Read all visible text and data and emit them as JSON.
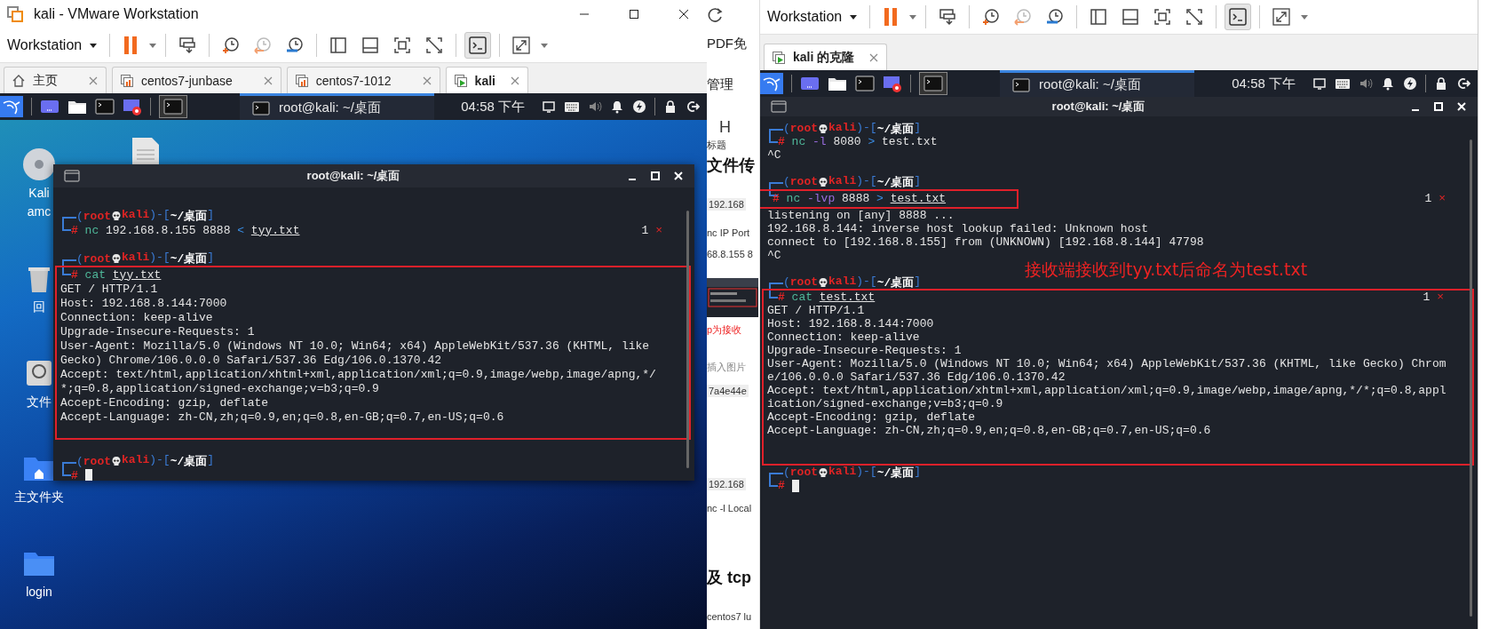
{
  "left_window": {
    "title": "kali - VMware Workstation",
    "menu": "Workstation",
    "console_pressed": true,
    "tabs": [
      {
        "label": "主页",
        "kind": "home",
        "selected": false
      },
      {
        "label": "centos7-junbase",
        "kind": "vm",
        "selected": false
      },
      {
        "label": "centos7-1012",
        "kind": "vm",
        "selected": false
      },
      {
        "label": "kali",
        "kind": "vm-running",
        "selected": true
      }
    ],
    "panel": {
      "window": "root@kali: ~/桌面",
      "clock": "04:58 下午"
    },
    "desktop_icons": [
      {
        "kind": "disc",
        "label_lines": [
          "Kali",
          "amc"
        ]
      },
      {
        "kind": "trash",
        "label_lines": [
          "回"
        ]
      },
      {
        "kind": "drive",
        "label_lines": [
          "文件"
        ]
      },
      {
        "kind": "home",
        "label_lines": [
          "主文件夹"
        ]
      },
      {
        "kind": "folder",
        "label_lines": [
          "login"
        ]
      }
    ],
    "terminal": {
      "title": "root@kali: ~/桌面",
      "entries": [
        {
          "kind": "blank"
        },
        {
          "kind": "prompt",
          "open": "(",
          "user": "root",
          "host": "kali",
          "sep": ")-[",
          "path": "~/桌面",
          "close": "]"
        },
        {
          "kind": "command",
          "hash": "#",
          "tokens": [
            {
              "kind": "cmd",
              "text": "nc"
            },
            {
              "kind": "arg",
              "text": "192.168.8.155 8888"
            },
            {
              "kind": "op",
              "text": "<"
            },
            {
              "kind": "file",
              "text": "tyy.txt"
            }
          ],
          "status": "1",
          "status_mark": "×"
        },
        {
          "kind": "blank"
        },
        {
          "kind": "prompt",
          "open": "(",
          "user": "root",
          "host": "kali",
          "sep": ")-[",
          "path": "~/桌面",
          "close": "]"
        },
        {
          "kind": "box",
          "entries": [
            {
              "kind": "command",
              "hash": "#",
              "tokens": [
                {
                  "kind": "cmd",
                  "text": "cat"
                },
                {
                  "kind": "file",
                  "text": "tyy.txt"
                }
              ]
            },
            {
              "kind": "output",
              "lines": [
                "GET / HTTP/1.1",
                "Host: 192.168.8.144:7000",
                "Connection: keep-alive",
                "Upgrade-Insecure-Requests: 1",
                "User-Agent: Mozilla/5.0 (Windows NT 10.0; Win64; x64) AppleWebKit/537.36 (KHTML, like",
                "Gecko) Chrome/106.0.0.0 Safari/537.36 Edg/106.0.1370.42",
                "Accept: text/html,application/xhtml+xml,application/xml;q=0.9,image/webp,image/apng,*/",
                "*;q=0.8,application/signed-exchange;v=b3;q=0.9",
                "Accept-Encoding: gzip, deflate",
                "Accept-Language: zh-CN,zh;q=0.9,en;q=0.8,en-GB;q=0.7,en-US;q=0.6"
              ]
            },
            {
              "kind": "blank"
            }
          ]
        },
        {
          "kind": "blank"
        },
        {
          "kind": "prompt",
          "open": "(",
          "user": "root",
          "host": "kali",
          "sep": ")-[",
          "path": "~/桌面",
          "close": "]"
        },
        {
          "kind": "command",
          "hash": "#",
          "cursor": true
        }
      ]
    }
  },
  "browser_strip": {
    "items": [
      {
        "kind": "reload"
      },
      {
        "kind": "text",
        "text": "PDF免"
      },
      {
        "kind": "text",
        "text": "管理"
      },
      {
        "kind": "big",
        "text": "H"
      },
      {
        "kind": "small",
        "text": "标题"
      },
      {
        "kind": "heading",
        "text": "文件传"
      },
      {
        "kind": "code",
        "text": "192.168"
      },
      {
        "kind": "small",
        "text": "nc IP Port"
      },
      {
        "kind": "small",
        "text": "68.8.155 8"
      },
      {
        "kind": "thumb"
      },
      {
        "kind": "red",
        "text": "p为接收"
      },
      {
        "kind": "muted",
        "text": "插入图片"
      },
      {
        "kind": "code",
        "text": "7a4e44e"
      },
      {
        "kind": "code",
        "text": "192.168"
      },
      {
        "kind": "small",
        "text": "nc -l Local"
      },
      {
        "kind": "heading",
        "text": "及 tcp"
      },
      {
        "kind": "small",
        "text": "centos7 lu"
      }
    ]
  },
  "right_window": {
    "menu": "Workstation",
    "console_pressed": true,
    "tabs": [
      {
        "label": "kali 的克隆",
        "kind": "vm-running",
        "selected": true
      }
    ],
    "panel": {
      "window": "root@kali: ~/桌面",
      "clock": "04:58 下午"
    },
    "terminal": {
      "title": "root@kali: ~/桌面",
      "entries": [
        {
          "kind": "prompt",
          "open": "(",
          "user": "root",
          "host": "kali",
          "sep": ")-[",
          "path": "~/桌面",
          "close": "]"
        },
        {
          "kind": "command",
          "hash": "#",
          "tokens": [
            {
              "kind": "cmd",
              "text": "nc"
            },
            {
              "kind": "flag",
              "text": "-l"
            },
            {
              "kind": "arg",
              "text": "8080"
            },
            {
              "kind": "op",
              "text": ">"
            },
            {
              "kind": "arg",
              "text": "test.txt"
            }
          ]
        },
        {
          "kind": "output",
          "lines": [
            "^C"
          ]
        },
        {
          "kind": "blank"
        },
        {
          "kind": "prompt",
          "open": "(",
          "user": "root",
          "host": "kali",
          "sep": ")-[",
          "path": "~/桌面",
          "close": "]"
        },
        {
          "kind": "command",
          "hash": "#",
          "boxed": true,
          "tokens": [
            {
              "kind": "cmd",
              "text": "nc"
            },
            {
              "kind": "flag",
              "text": "-lvp"
            },
            {
              "kind": "arg",
              "text": "8888"
            },
            {
              "kind": "op",
              "text": ">"
            },
            {
              "kind": "file",
              "text": "test.txt"
            }
          ],
          "status": "1",
          "status_mark": "×"
        },
        {
          "kind": "output",
          "lines": [
            "listening on [any] 8888 ...",
            "192.168.8.144: inverse host lookup failed: Unknown host",
            "connect to [192.168.8.155] from (UNKNOWN) [192.168.8.144] 47798",
            "^C"
          ]
        },
        {
          "kind": "annotation",
          "text": "接收端接收到tyy.txt后命名为test.txt"
        },
        {
          "kind": "prompt",
          "open": "(",
          "user": "root",
          "host": "kali",
          "sep": ")-[",
          "path": "~/桌面",
          "close": "]"
        },
        {
          "kind": "box",
          "entries": [
            {
              "kind": "command",
              "hash": "#",
              "tokens": [
                {
                  "kind": "cmd",
                  "text": "cat"
                },
                {
                  "kind": "file",
                  "text": "test.txt"
                }
              ],
              "status": "1",
              "status_mark": "×"
            },
            {
              "kind": "output",
              "lines": [
                "GET / HTTP/1.1",
                "Host: 192.168.8.144:7000",
                "Connection: keep-alive",
                "Upgrade-Insecure-Requests: 1",
                "User-Agent: Mozilla/5.0 (Windows NT 10.0; Win64; x64) AppleWebKit/537.36 (KHTML, like Gecko) Chrom",
                "e/106.0.0.0 Safari/537.36 Edg/106.0.1370.42",
                "Accept: text/html,application/xhtml+xml,application/xml;q=0.9,image/webp,image/apng,*/*;q=0.8,appl",
                "ication/signed-exchange;v=b3;q=0.9",
                "Accept-Encoding: gzip, deflate",
                "Accept-Language: zh-CN,zh;q=0.9,en;q=0.8,en-GB;q=0.7,en-US;q=0.6"
              ]
            },
            {
              "kind": "blank"
            },
            {
              "kind": "blank"
            }
          ]
        },
        {
          "kind": "prompt",
          "open": "(",
          "user": "root",
          "host": "kali",
          "sep": ")-[",
          "path": "~/桌面",
          "close": "]"
        },
        {
          "kind": "command",
          "hash": "#",
          "cursor": true
        }
      ]
    }
  }
}
